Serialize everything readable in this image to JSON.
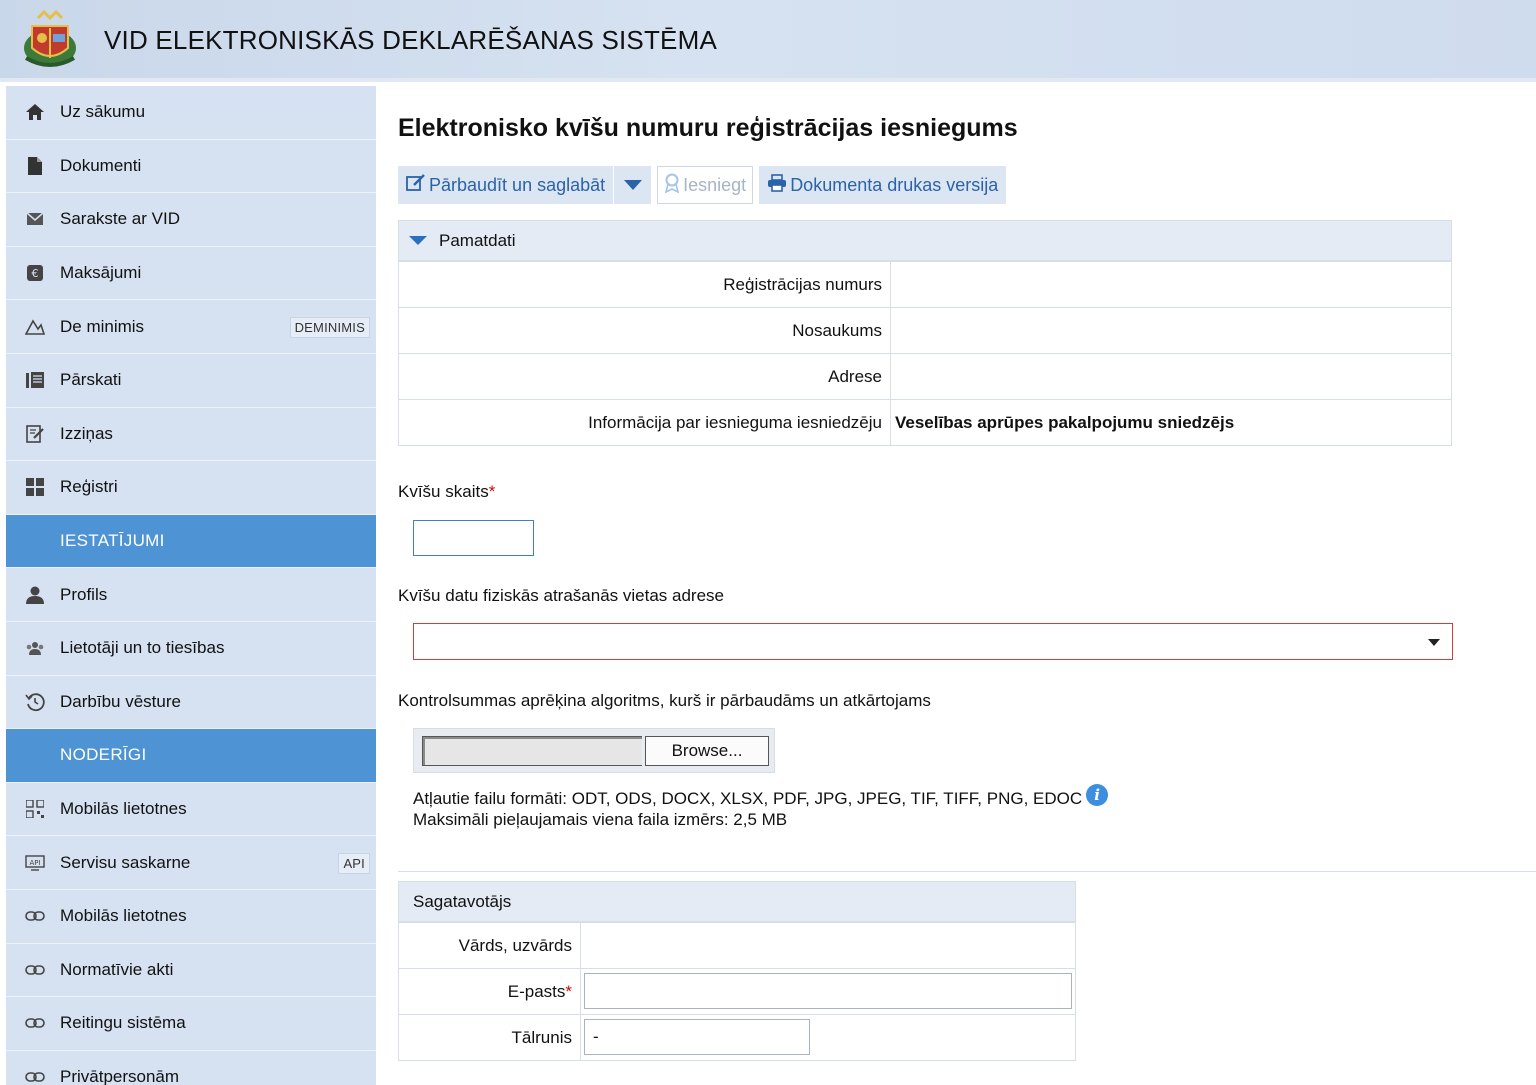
{
  "header": {
    "title": "VID ELEKTRONISKĀS DEKLARĒŠANAS SISTĒMA"
  },
  "sidebar": {
    "items_top": [
      {
        "label": "Uz sākumu",
        "icon": "home-icon"
      },
      {
        "label": "Dokumenti",
        "icon": "document-icon"
      },
      {
        "label": "Sarakste ar VID",
        "icon": "mail-icon"
      },
      {
        "label": "Maksājumi",
        "icon": "payment-icon"
      },
      {
        "label": "De minimis",
        "icon": "chart-icon",
        "tag": "DEMINIMIS"
      },
      {
        "label": "Pārskati",
        "icon": "reports-icon"
      },
      {
        "label": "Izziņas",
        "icon": "certificate-icon"
      },
      {
        "label": "Reģistri",
        "icon": "grid-icon"
      }
    ],
    "section_settings": "IESTATĪJUMI",
    "items_settings": [
      {
        "label": "Profils",
        "icon": "user-icon"
      },
      {
        "label": "Lietotāji un to tiesības",
        "icon": "users-icon"
      },
      {
        "label": "Darbību vēsture",
        "icon": "history-icon"
      }
    ],
    "section_useful": "NODERĪGI",
    "items_useful": [
      {
        "label": "Mobilās lietotnes",
        "icon": "qr-icon"
      },
      {
        "label": "Servisu saskarne",
        "icon": "api-icon",
        "tag": "API"
      },
      {
        "label": "Mobilās lietotnes",
        "icon": "link-icon"
      },
      {
        "label": "Normatīvie akti",
        "icon": "link-icon"
      },
      {
        "label": "Reitingu sistēma",
        "icon": "link-icon"
      },
      {
        "label": "Privātpersonām",
        "icon": "link-icon"
      }
    ]
  },
  "main": {
    "title": "Elektronisko kvīšu numuru reģistrācijas iesniegums",
    "toolbar": {
      "check_save": "Pārbaudīt un saglabāt",
      "submit": "Iesniegt",
      "print": "Dokumenta drukas versija"
    },
    "basic": {
      "heading": "Pamatdati",
      "rows": [
        {
          "label": "Reģistrācijas numurs",
          "value": ""
        },
        {
          "label": "Nosaukums",
          "value": ""
        },
        {
          "label": "Adrese",
          "value": ""
        },
        {
          "label": "Informācija par iesnieguma iesniedzēju",
          "value": "Veselības aprūpes pakalpojumu sniedzējs"
        }
      ]
    },
    "receipt_count": {
      "label": "Kvīšu skaits",
      "required": "*",
      "value": ""
    },
    "address": {
      "label": "Kvīšu datu fiziskās atrašanās vietas adrese",
      "value": ""
    },
    "checksum": {
      "label": "Kontrolsummas aprēķina algoritms, kurš ir pārbaudāms un atkārtojams",
      "browse": "Browse..."
    },
    "formats_line": "Atļautie failu formāti: ODT, ODS, DOCX, XLSX, PDF, JPG, JPEG, TIF, TIFF, PNG, EDOC",
    "maxsize_line": "Maksimāli pieļaujamais viena faila izmērs: 2,5 MB",
    "preparer": {
      "heading": "Sagatavotājs",
      "name_label": "Vārds, uzvārds",
      "name_value": "",
      "email_label": "E-pasts",
      "email_required": "*",
      "email_value": "",
      "phone_label": "Tālrunis",
      "phone_value": "-"
    }
  },
  "colors": {
    "accent": "#4e93d3",
    "sidebar_bg": "#d6e2f1",
    "link": "#2a63a8",
    "error_border": "#d43c3c"
  }
}
